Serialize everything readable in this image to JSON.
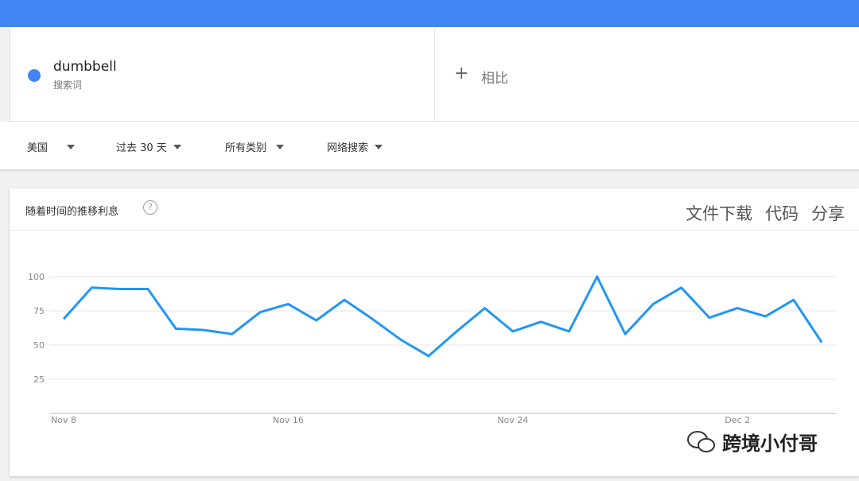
{
  "search_term": {
    "name": "dumbbell",
    "type": "搜索词"
  },
  "compare": {
    "icon": "plus-icon",
    "label": "相比"
  },
  "filters": [
    {
      "label": "美国"
    },
    {
      "label": "过去 30 天"
    },
    {
      "label": "所有类别"
    },
    {
      "label": "网络搜索"
    }
  ],
  "card": {
    "title": "随着时间的推移利息",
    "help": "?",
    "actions": [
      "文件下载",
      "代码",
      "分享"
    ]
  },
  "watermark": "跨境小付哥",
  "colors": {
    "header": "#4285f4",
    "series": "#2196f3",
    "term_dot": "#4285f4"
  },
  "chart_data": {
    "type": "line",
    "ylim": [
      0,
      100
    ],
    "yticks": [
      25,
      50,
      75,
      100
    ],
    "xtick_labels": [
      "Nov 8",
      "Nov 16",
      "Nov 24",
      "Dec 2"
    ],
    "x": [
      "Nov 8",
      "Nov 9",
      "Nov 10",
      "Nov 11",
      "Nov 12",
      "Nov 13",
      "Nov 14",
      "Nov 15",
      "Nov 16",
      "Nov 17",
      "Nov 18",
      "Nov 19",
      "Nov 20",
      "Nov 21",
      "Nov 22",
      "Nov 23",
      "Nov 24",
      "Nov 25",
      "Nov 26",
      "Nov 27",
      "Nov 28",
      "Nov 29",
      "Nov 30",
      "Dec 1",
      "Dec 2",
      "Dec 3",
      "Dec 4",
      "Dec 5"
    ],
    "series": [
      {
        "values": [
          69,
          92,
          91,
          91,
          62,
          61,
          58,
          74,
          80,
          68,
          83,
          69,
          54,
          42,
          60,
          77,
          60,
          67,
          60,
          100,
          58,
          80,
          92,
          70,
          77,
          71,
          83,
          52
        ]
      }
    ]
  }
}
